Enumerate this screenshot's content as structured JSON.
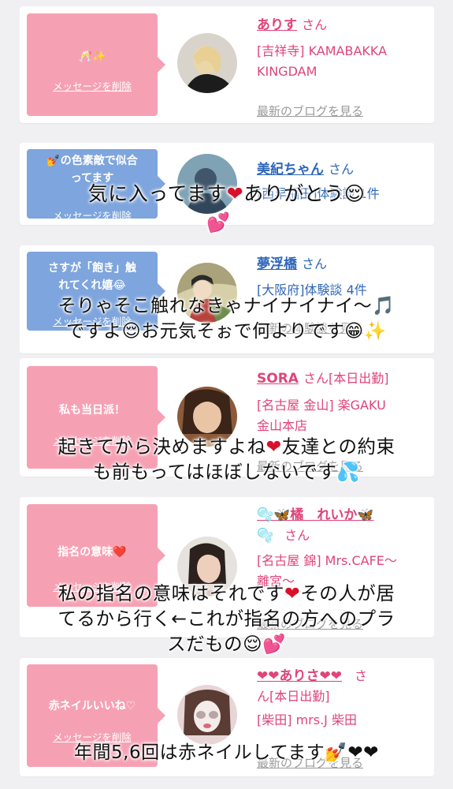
{
  "cards": [
    {
      "bubble_text": "🥂✨",
      "delete_label": "メッセージを削除",
      "name": "ありす",
      "honorific": "さん",
      "shop_line1": "[吉祥寺] KAMABAKKA",
      "shop_line2": "KINGDAM",
      "link": "最新のブログを見る"
    },
    {
      "bubble_line1": "💅の色素敵で似合",
      "bubble_line2": "ってます",
      "delete_label": "メッセージを削除",
      "name": "美紀ちゃん",
      "honorific": "さん",
      "shop_line1": "[西早稲田]体験談 1件"
    },
    {
      "bubble_line1": "さすが「飽き」触",
      "bubble_line2": "れてくれ嬉😂",
      "delete_label": "メッセージを削除",
      "name": "夢浮橋",
      "honorific": "さん",
      "shop_line1": "[大阪府]体験談 4件",
      "link": "最新の体験談を見る"
    },
    {
      "bubble_text": "私も当日派！",
      "delete_label": "メッセージを削除",
      "name": "SORA",
      "honorific": "さん",
      "status": "[本日出勤]",
      "shop_line1": "[名古屋 金山] 楽GAKU",
      "shop_line2": "金山本店",
      "link": "最新のブログを見る"
    },
    {
      "bubble_text": "指名の意味❤️",
      "delete_label": "メッセージを削除",
      "name": "🫧🦋橘　れいか🦋",
      "name_line2": "🫧",
      "honorific": "さん",
      "shop_line1": "[名古屋 錦] Mrs.CAFE〜",
      "shop_line2": "離宮〜",
      "link": "最新のブログを見る"
    },
    {
      "bubble_text": "赤ネイルいいね♡",
      "delete_label": "メッセージを削除",
      "name": "❤❤ありさ❤❤",
      "honorific": "さ",
      "honorific_line2": "ん",
      "status": "[本日出勤]",
      "shop_line1": "[柴田] mrs.J 柴田",
      "link": "最新のブログを見る"
    }
  ],
  "overlays": [
    {
      "text_a": "気に入ってます",
      "text_b": "ありがとう😌",
      "text_c": "💕"
    },
    {
      "line1": "そりゃそこ触れなきゃナイナイナイ〜🎵",
      "line2": "ですよ😌お元気そぉで何よりです😁✨"
    },
    {
      "line1_a": "起きてから決めますよね",
      "line1_b": "友達との約束",
      "line2": "も前もってはほぼしないです💦"
    },
    {
      "line1_a": "私の指名の意味はそれです",
      "line1_b": "その人が居",
      "line2": "てるから行く←これが指名の方へのプラ",
      "line3": "スだもの😌💕"
    },
    {
      "text": "年間5,6回は赤ネイルしてます💅❤❤"
    }
  ],
  "colors": {
    "pink": "#f6a1b3",
    "blue": "#7ea5dd",
    "name_pink": "#e0447a",
    "name_blue": "#2f67b8",
    "heart": "#d8102a"
  }
}
